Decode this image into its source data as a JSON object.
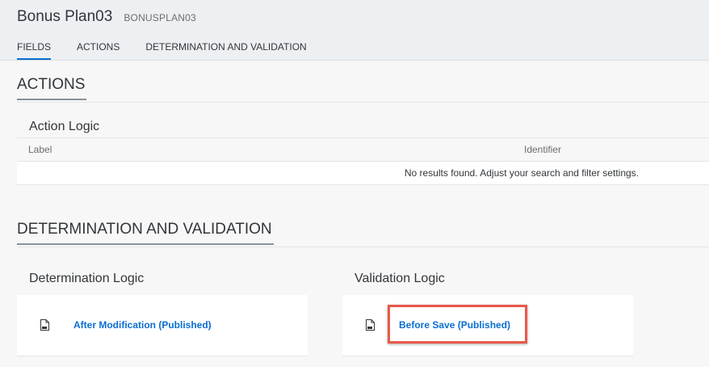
{
  "header": {
    "title": "Bonus Plan03",
    "subtitle": "BONUSPLAN03",
    "tabs": [
      {
        "label": "FIELDS",
        "active": true
      },
      {
        "label": "ACTIONS",
        "active": false
      },
      {
        "label": "DETERMINATION AND VALIDATION",
        "active": false
      }
    ]
  },
  "actions_section": {
    "title": "ACTIONS",
    "table": {
      "title": "Action Logic",
      "columns": [
        "Label",
        "Identifier"
      ],
      "empty_message": "No results found. Adjust your search and filter settings."
    }
  },
  "dv_section": {
    "title": "DETERMINATION AND VALIDATION",
    "determination": {
      "title": "Determination Logic",
      "item": "After Modification (Published)",
      "icon": "document-icon"
    },
    "validation": {
      "title": "Validation Logic",
      "item": "Before Save (Published)",
      "icon": "document-icon"
    }
  },
  "colors": {
    "accent": "#0a6ed1",
    "highlight": "#e8584a"
  }
}
